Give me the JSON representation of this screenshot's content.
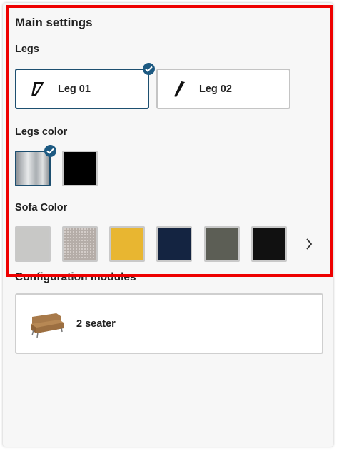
{
  "main_settings": {
    "title": "Main settings",
    "legs": {
      "label": "Legs",
      "options": [
        {
          "label": "Leg 01",
          "selected": true,
          "icon": "angled-leg-icon"
        },
        {
          "label": "Leg 02",
          "selected": false,
          "icon": "tapered-leg-icon"
        }
      ]
    },
    "legs_color": {
      "label": "Legs color",
      "options": [
        {
          "name": "chrome",
          "color": "#b8bcc0",
          "selected": true
        },
        {
          "name": "black",
          "color": "#000000",
          "selected": false
        }
      ]
    },
    "sofa_color": {
      "label": "Sofa Color",
      "swatches": [
        {
          "color": "#c8c8c6"
        },
        {
          "color": "#b5ada8"
        },
        {
          "color": "#e8b631"
        },
        {
          "color": "#142441"
        },
        {
          "color": "#5c5e55"
        },
        {
          "color": "#111111"
        }
      ],
      "next_icon": "chevron-right-icon"
    }
  },
  "configuration_modules": {
    "label": "Configuration modules",
    "items": [
      {
        "label": "2 seater",
        "icon": "sofa-thumbnail"
      }
    ]
  },
  "colors": {
    "selected_border": "#1d4f70",
    "check_badge": "#1d5a82",
    "highlight": "#ee0000"
  }
}
